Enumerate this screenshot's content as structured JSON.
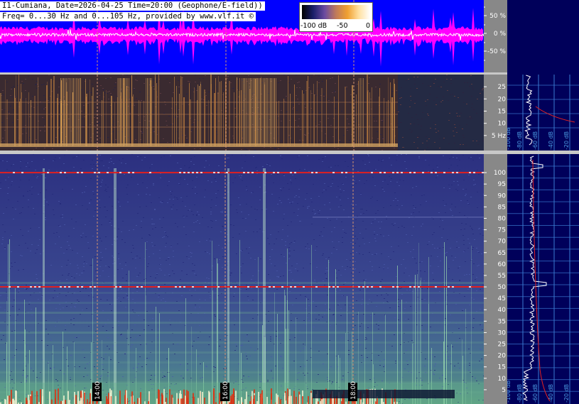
{
  "header": {
    "line1": "I1-Cumiana, Date=2026-04-25 Time=20:00 (Geophone/E-field))",
    "line2": "Freq= 0...30 Hz and 0...105 Hz, provided by www.vlf.it ©"
  },
  "colorbar": {
    "labels": [
      "-100 dB",
      "-50",
      "0"
    ],
    "stops": [
      "#000000",
      "#1a1f6a",
      "#6b4aa0",
      "#c07a5a",
      "#f0a030",
      "#ffe0a0",
      "#ffffff"
    ]
  },
  "colors": {
    "waveform_bg": "#0000ff",
    "waveform_envelope": "#ff00ff",
    "waveform_signal": "#ffffff",
    "axis_bg": "#888888",
    "side_panel_bg": "#00005a",
    "side_grid": "#3a7ad0",
    "low_band_bg": "#3a2a30",
    "high_band_bg": "#32388a",
    "hline_50": "#e02020",
    "hline_100": "#e02020",
    "marker_line": "#d09070"
  },
  "chart_data": [
    {
      "type": "line",
      "title": "",
      "description_panel": "waveform",
      "ylabel_ticks": [
        "50 %",
        "0 %",
        "-50 %"
      ],
      "ylim": [
        -100,
        100
      ]
    },
    {
      "type": "heatmap",
      "panel": "spectrogram-low",
      "ylim": [
        0,
        30
      ],
      "y_ticks": [
        {
          "value": 25,
          "label": "25"
        },
        {
          "value": 20,
          "label": "20"
        },
        {
          "value": 15,
          "label": "15"
        },
        {
          "value": 10,
          "label": "10"
        },
        {
          "value": 5,
          "label": "5 Hz"
        }
      ]
    },
    {
      "type": "heatmap",
      "panel": "spectrogram-high",
      "ylim": [
        0,
        105
      ],
      "y_ticks": [
        {
          "value": 100,
          "label": "100"
        },
        {
          "value": 95,
          "label": "95"
        },
        {
          "value": 90,
          "label": "90"
        },
        {
          "value": 85,
          "label": "85"
        },
        {
          "value": 80,
          "label": "80"
        },
        {
          "value": 75,
          "label": "75"
        },
        {
          "value": 70,
          "label": "70"
        },
        {
          "value": 65,
          "label": "65"
        },
        {
          "value": 60,
          "label": "60"
        },
        {
          "value": 55,
          "label": "55"
        },
        {
          "value": 50,
          "label": "50"
        },
        {
          "value": 45,
          "label": "45"
        },
        {
          "value": 40,
          "label": "40"
        },
        {
          "value": 35,
          "label": "35"
        },
        {
          "value": 30,
          "label": "30"
        },
        {
          "value": 25,
          "label": "25"
        },
        {
          "value": 20,
          "label": "20"
        },
        {
          "value": 15,
          "label": "15"
        },
        {
          "value": 10,
          "label": "10"
        },
        {
          "value": 5,
          "label": "5"
        }
      ],
      "x_time_labels": [
        "14:00",
        "16:00",
        "18:00"
      ],
      "horizontal_lines_hz": [
        50,
        100
      ]
    }
  ],
  "side_panel": {
    "top_labels": [
      "-100 dB",
      "-80 dB",
      "-60 dB",
      "-40 dB",
      "-20 dB"
    ],
    "bottom_labels": [
      "-100 dB",
      "-80 dB",
      "-60 dB",
      "-40 dB",
      "-20 dB"
    ]
  }
}
